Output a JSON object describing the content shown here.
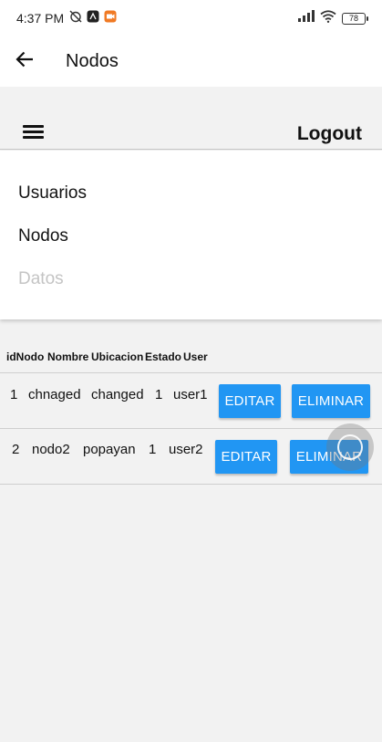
{
  "status_bar": {
    "time": "4:37 PM",
    "battery": "78"
  },
  "appbar": {
    "title": "Nodos",
    "back_icon": "arrow-left-icon"
  },
  "navbar": {
    "menu_icon": "hamburger-icon",
    "logout_label": "Logout"
  },
  "menu": {
    "items": [
      {
        "label": "Usuarios",
        "enabled": true
      },
      {
        "label": "Nodos",
        "enabled": true
      },
      {
        "label": "Datos",
        "enabled": false
      }
    ]
  },
  "table": {
    "headers": [
      "idNodo",
      "Nombre",
      "Ubicacion",
      "Estado",
      "User"
    ],
    "rows": [
      {
        "idNodo": "1",
        "nombre": "chnaged",
        "ubicacion": "changed",
        "estado": "1",
        "user": "user1",
        "edit_label": "EDITAR",
        "delete_label": "ELIMINAR"
      },
      {
        "idNodo": "2",
        "nombre": "nodo2",
        "ubicacion": "popayan",
        "estado": "1",
        "user": "user2",
        "edit_label": "EDITAR",
        "delete_label": "ELIMINAR"
      }
    ]
  },
  "colors": {
    "button": "#2196f3",
    "background": "#f2f2f2",
    "surface": "#ffffff",
    "disabled_text": "#c4c4c4"
  }
}
